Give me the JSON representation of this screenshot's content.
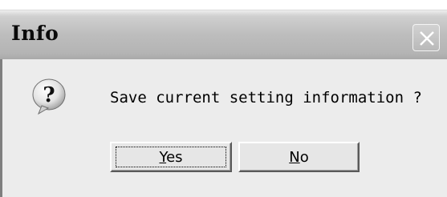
{
  "dialog": {
    "title": "Info",
    "message": "Save current setting information ?",
    "buttons": {
      "yes": {
        "mnemonic": "Y",
        "rest": "es"
      },
      "no": {
        "mnemonic": "N",
        "rest": "o"
      }
    }
  },
  "icons": {
    "question": "question-bubble-icon",
    "close": "close-x-icon"
  },
  "colors": {
    "titlebar": "#bdbdbd",
    "body": "#ececec",
    "button_face": "#e6e6e6"
  }
}
